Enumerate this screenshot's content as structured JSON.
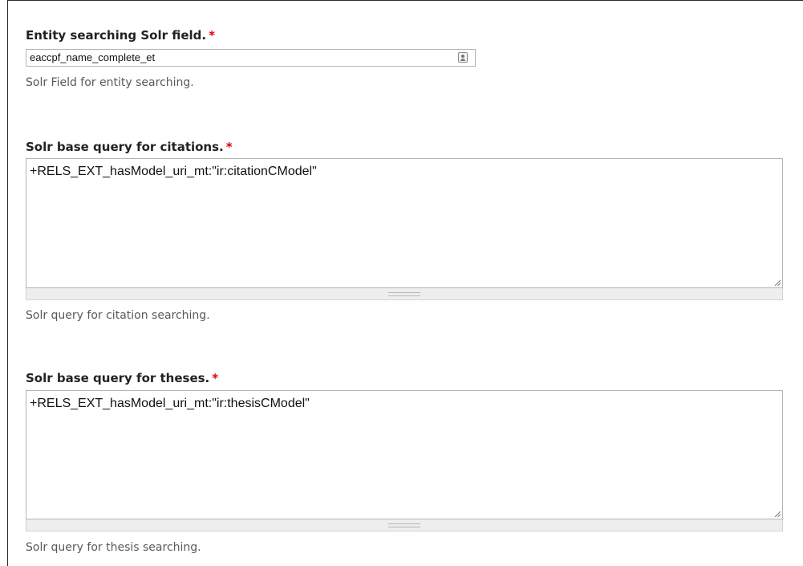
{
  "fields": [
    {
      "label": "Entity searching Solr field.",
      "required_mark": "*",
      "value": "eaccpf_name_complete_et",
      "description": "Solr Field for entity searching.",
      "icon": "contact-card-icon"
    },
    {
      "label": "Solr base query for citations.",
      "required_mark": "*",
      "value": "+RELS_EXT_hasModel_uri_mt:\"ir:citationCModel\"",
      "description": "Solr query for citation searching."
    },
    {
      "label": "Solr base query for theses.",
      "required_mark": "*",
      "value": "+RELS_EXT_hasModel_uri_mt:\"ir:thesisCModel\"",
      "description": "Solr query for thesis searching."
    }
  ],
  "colors": {
    "required": "#e00000",
    "label": "#222222",
    "description": "#595959"
  }
}
